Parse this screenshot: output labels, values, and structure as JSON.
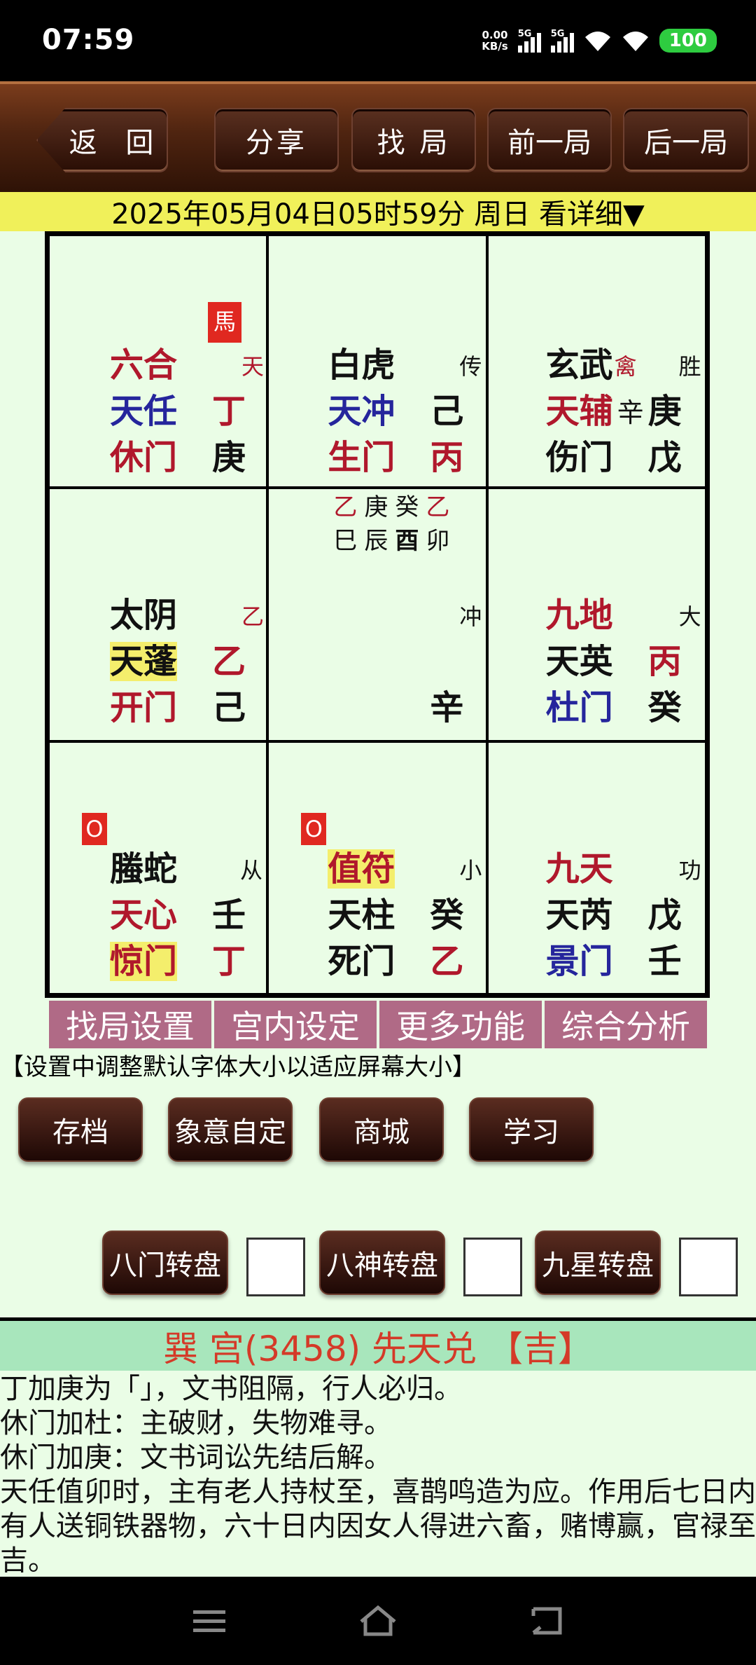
{
  "status": {
    "time": "07:59",
    "net_speed_value": "0.00",
    "net_speed_unit": "KB/s",
    "sig1": "5G",
    "sig2": "5G",
    "battery": "100"
  },
  "toolbar": {
    "back": "返 回",
    "share": "分享",
    "find": "找 局",
    "prev": "前一局",
    "next": "后一局"
  },
  "date_bar": "2025年05月04日05时59分 周日 看详细▼",
  "grid": {
    "c1": {
      "mark": "馬",
      "deity": "六合",
      "corner": "天",
      "star": "天任",
      "star_stem": "丁",
      "door": "休门",
      "door_stem": "庚"
    },
    "c2": {
      "deity": "白虎",
      "corner": "传",
      "star": "天冲",
      "star_stem": "己",
      "door": "生门",
      "door_stem": "丙"
    },
    "c3": {
      "deity": "玄武",
      "deity_extra": "禽",
      "corner": "胜",
      "star": "天辅",
      "star_stem_small": "辛",
      "star_stem": "庚",
      "door": "伤门",
      "door_stem": "戊"
    },
    "c4": {
      "deity": "太阴",
      "corner": "乙",
      "star": "天蓬",
      "star_stem": "乙",
      "door": "开门",
      "door_stem": "己"
    },
    "c5": {
      "row1": [
        "乙",
        "庚",
        "癸",
        "乙"
      ],
      "row2": [
        "巳",
        "辰",
        "酉",
        "卯"
      ],
      "corner": "冲",
      "door_stem": "辛"
    },
    "c6": {
      "deity": "九地",
      "corner": "大",
      "star": "天英",
      "star_stem": "丙",
      "door": "杜门",
      "door_stem": "癸"
    },
    "c7": {
      "mark": "O",
      "deity": "螣蛇",
      "corner": "从",
      "star": "天心",
      "star_stem": "壬",
      "door": "惊门",
      "door_stem": "丁"
    },
    "c8": {
      "mark": "O",
      "deity": "值符",
      "corner": "小",
      "star": "天柱",
      "star_stem": "癸",
      "door": "死门",
      "door_stem": "乙"
    },
    "c9": {
      "deity": "九天",
      "corner": "功",
      "star": "天芮",
      "star_stem": "戊",
      "door": "景门",
      "door_stem": "壬"
    }
  },
  "tabs": [
    "找局设置",
    "宫内设定",
    "更多功能",
    "综合分析"
  ],
  "tip": "【设置中调整默认字体大小以适应屏幕大小】",
  "buttons": {
    "archive": "存档",
    "custom": "象意自定",
    "shop": "商城",
    "learn": "学习"
  },
  "rotate": {
    "door": "八门转盘",
    "god": "八神转盘",
    "star": "九星转盘"
  },
  "result": {
    "title": "巽 宫(3458) 先天兑 【吉】",
    "lines": [
      "丁加庚为「」，文书阻隔，行人必归。",
      "休门加杜：主破财，失物难寻。",
      "休门加庚：文书词讼先结后解。",
      "天任值卯时，主有老人持杖至，喜鹊鸣造为应。作用后七日内有人送铜铁器物，六十日内因女人得进六畜，赌博赢，官禄至吉。"
    ]
  },
  "colors": {
    "red": "#b0182c",
    "blue": "#25259c",
    "highlight": "#f4ee6c",
    "tab": "#b06a86",
    "datebar": "#f0f05a"
  }
}
